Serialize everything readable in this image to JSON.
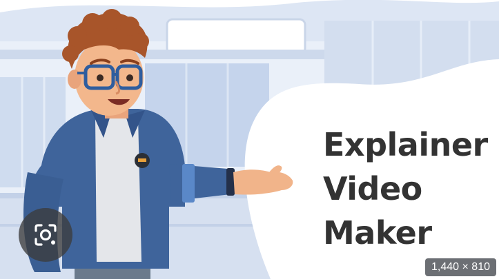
{
  "headline": {
    "line1": "Explainer",
    "line2": "Video",
    "line3": "Maker"
  },
  "image_info": {
    "dimensions": "1,440 × 810"
  },
  "icons": {
    "lens": "google-lens-camera-icon"
  },
  "colors": {
    "text": "#333333",
    "jacket": "#3f649b",
    "hair": "#a8552a",
    "badge_bg": "#5f6368"
  }
}
